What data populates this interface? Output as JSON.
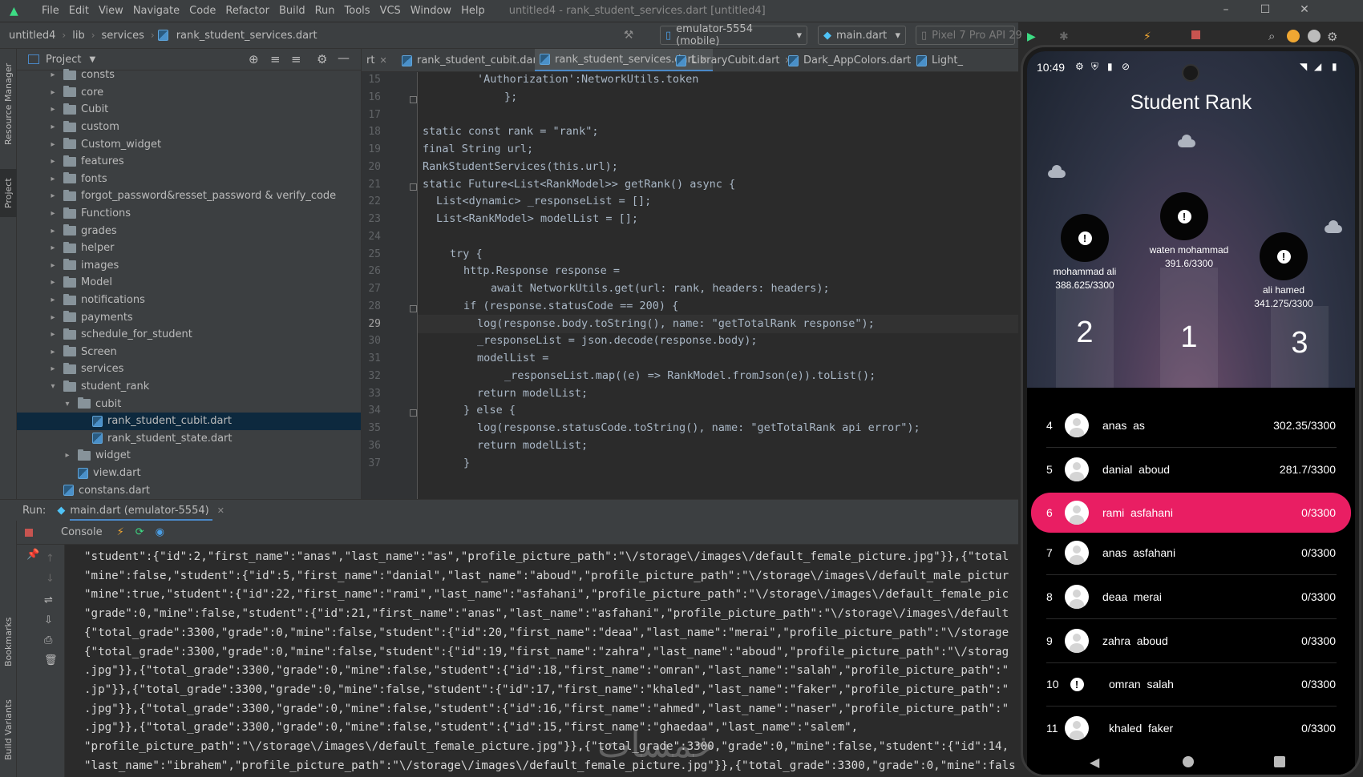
{
  "menubar": {
    "items": [
      "File",
      "Edit",
      "View",
      "Navigate",
      "Code",
      "Refactor",
      "Build",
      "Run",
      "Tools",
      "VCS",
      "Window",
      "Help"
    ],
    "title": "untitled4 - rank_student_services.dart [untitled4]"
  },
  "navbar": {
    "crumbs": [
      "untitled4",
      "lib",
      "services",
      "rank_student_services.dart"
    ],
    "device": "emulator-5554 (mobile)",
    "run_config": "main.dart",
    "avd": "Pixel 7 Pro API 29"
  },
  "leftstripe": {
    "tabs": [
      "Resource Manager",
      "Project",
      "Bookmarks",
      "Build Variants"
    ]
  },
  "project": {
    "header": "Project",
    "tree": [
      {
        "label": "consts",
        "type": "folder",
        "depth": 0,
        "expanded": false
      },
      {
        "label": "core",
        "type": "folder",
        "depth": 0,
        "expanded": false
      },
      {
        "label": "Cubit",
        "type": "folder",
        "depth": 0,
        "expanded": false
      },
      {
        "label": "custom",
        "type": "folder",
        "depth": 0,
        "expanded": false
      },
      {
        "label": "Custom_widget",
        "type": "folder",
        "depth": 0,
        "expanded": false
      },
      {
        "label": "features",
        "type": "folder",
        "depth": 0,
        "expanded": false
      },
      {
        "label": "fonts",
        "type": "folder",
        "depth": 0,
        "expanded": false
      },
      {
        "label": "forgot_password&resset_password & verify_code",
        "type": "folder",
        "depth": 0,
        "expanded": false
      },
      {
        "label": "Functions",
        "type": "folder",
        "depth": 0,
        "expanded": false
      },
      {
        "label": "grades",
        "type": "folder",
        "depth": 0,
        "expanded": false
      },
      {
        "label": "helper",
        "type": "folder",
        "depth": 0,
        "expanded": false
      },
      {
        "label": "images",
        "type": "folder",
        "depth": 0,
        "expanded": false
      },
      {
        "label": "Model",
        "type": "folder",
        "depth": 0,
        "expanded": false
      },
      {
        "label": "notifications",
        "type": "folder",
        "depth": 0,
        "expanded": false
      },
      {
        "label": "payments",
        "type": "folder",
        "depth": 0,
        "expanded": false
      },
      {
        "label": "schedule_for_student",
        "type": "folder",
        "depth": 0,
        "expanded": false
      },
      {
        "label": "Screen",
        "type": "folder",
        "depth": 0,
        "expanded": false
      },
      {
        "label": "services",
        "type": "folder",
        "depth": 0,
        "expanded": false
      },
      {
        "label": "student_rank",
        "type": "folder",
        "depth": 0,
        "expanded": true
      },
      {
        "label": "cubit",
        "type": "folder",
        "depth": 1,
        "expanded": true
      },
      {
        "label": "rank_student_cubit.dart",
        "type": "file",
        "depth": 2,
        "selected": true
      },
      {
        "label": "rank_student_state.dart",
        "type": "file",
        "depth": 2
      },
      {
        "label": "widget",
        "type": "folder",
        "depth": 1,
        "expanded": false
      },
      {
        "label": "view.dart",
        "type": "file",
        "depth": 1
      },
      {
        "label": "constans.dart",
        "type": "file",
        "depth": 0
      }
    ]
  },
  "editor_tabs": [
    {
      "label": "rt",
      "active": false
    },
    {
      "label": "rank_student_cubit.dart",
      "active": false
    },
    {
      "label": "rank_student_services.dart",
      "active": true
    },
    {
      "label": "LibraryCubit.dart",
      "active": false
    },
    {
      "label": "Dark_AppColors.dart",
      "active": false
    },
    {
      "label": "Light_",
      "active": false
    }
  ],
  "code": {
    "line_numbers": [
      "15",
      "16",
      "17",
      "18",
      "19",
      "20",
      "21",
      "22",
      "23",
      "24",
      "25",
      "26",
      "27",
      "28",
      "29",
      "30",
      "31",
      "32",
      "33",
      "34",
      "35",
      "36",
      "37"
    ],
    "lines": [
      "'Authorization':NetworkUtils.token",
      "};",
      "",
      "static const rank = \"rank\";",
      "final String url;",
      "RankStudentServices(this.url);",
      "static Future<List<RankModel>> getRank() async {",
      "List<dynamic> _responseList = [];",
      "List<RankModel> modelList = [];",
      "",
      "try {",
      "http.Response response =",
      "await NetworkUtils.get(url: rank, headers: headers);",
      "if (response.statusCode == 200) {",
      "log(response.body.toString(), name: \"getTotalRank response\");",
      "_responseList = json.decode(response.body);",
      "modelList =",
      "_responseList.map((e) => RankModel.fromJson(e)).toList();",
      "return modelList;",
      "} else {",
      "log(response.statusCode.toString(), name: \"getTotalRank api error\");",
      "return modelList;",
      "}"
    ]
  },
  "run": {
    "label": "Run:",
    "tab": "main.dart (emulator-5554)",
    "console_tab": "Console"
  },
  "console_lines": [
    "\"student\":{\"id\":2,\"first_name\":\"anas\",\"last_name\":\"as\",\"profile_picture_path\":\"\\/storage\\/images\\/default_female_picture.jpg\"}},{\"total",
    "\"mine\":false,\"student\":{\"id\":5,\"first_name\":\"danial\",\"last_name\":\"aboud\",\"profile_picture_path\":\"\\/storage\\/images\\/default_male_pictur",
    "\"mine\":true,\"student\":{\"id\":22,\"first_name\":\"rami\",\"last_name\":\"asfahani\",\"profile_picture_path\":\"\\/storage\\/images\\/default_female_pic",
    "\"grade\":0,\"mine\":false,\"student\":{\"id\":21,\"first_name\":\"anas\",\"last_name\":\"asfahani\",\"profile_picture_path\":\"\\/storage\\/images\\/default",
    "{\"total_grade\":3300,\"grade\":0,\"mine\":false,\"student\":{\"id\":20,\"first_name\":\"deaa\",\"last_name\":\"merai\",\"profile_picture_path\":\"\\/storage",
    "{\"total_grade\":3300,\"grade\":0,\"mine\":false,\"student\":{\"id\":19,\"first_name\":\"zahra\",\"last_name\":\"aboud\",\"profile_picture_path\":\"\\/storag",
    ".jpg\"}},{\"total_grade\":3300,\"grade\":0,\"mine\":false,\"student\":{\"id\":18,\"first_name\":\"omran\",\"last_name\":\"salah\",\"profile_picture_path\":\"",
    ".jp\"}},{\"total_grade\":3300,\"grade\":0,\"mine\":false,\"student\":{\"id\":17,\"first_name\":\"khaled\",\"last_name\":\"faker\",\"profile_picture_path\":\"",
    ".jpg\"}},{\"total_grade\":3300,\"grade\":0,\"mine\":false,\"student\":{\"id\":16,\"first_name\":\"ahmed\",\"last_name\":\"naser\",\"profile_picture_path\":\"",
    ".jpg\"}},{\"total_grade\":3300,\"grade\":0,\"mine\":false,\"student\":{\"id\":15,\"first_name\":\"ghaedaa\",\"last_name\":\"salem\",",
    "\"profile_picture_path\":\"\\/storage\\/images\\/default_female_picture.jpg\"}},{\"total_grade\":3300,\"grade\":0,\"mine\":false,\"student\":{\"id\":14,",
    "\"last_name\":\"ibrahem\",\"profile_picture_path\":\"\\/storage\\/images\\/default_female_picture.jpg\"}},{\"total_grade\":3300,\"grade\":0,\"mine\":fals"
  ],
  "watermark": "خمسات",
  "phone": {
    "time": "10:49",
    "title": "Student Rank",
    "podium": [
      {
        "place": "2",
        "name": "mohammad ali",
        "score": "388.625/3300"
      },
      {
        "place": "1",
        "name": "waten mohammad",
        "score": "391.6/3300"
      },
      {
        "place": "3",
        "name": "ali hamed",
        "score": "341.275/3300"
      }
    ],
    "list": [
      {
        "rank": "4",
        "name": "anas  as",
        "grade": "302.35/3300",
        "mine": false,
        "pic": "person"
      },
      {
        "rank": "5",
        "name": "danial  aboud",
        "grade": "281.7/3300",
        "mine": false,
        "pic": "person"
      },
      {
        "rank": "6",
        "name": "rami  asfahani",
        "grade": "0/3300",
        "mine": true,
        "pic": "person"
      },
      {
        "rank": "7",
        "name": "anas  asfahani",
        "grade": "0/3300",
        "mine": false,
        "pic": "person"
      },
      {
        "rank": "8",
        "name": "deaa  merai",
        "grade": "0/3300",
        "mine": false,
        "pic": "person"
      },
      {
        "rank": "9",
        "name": "zahra  aboud",
        "grade": "0/3300",
        "mine": false,
        "pic": "person"
      },
      {
        "rank": "10",
        "name": "omran  salah",
        "grade": "0/3300",
        "mine": false,
        "pic": "warning"
      },
      {
        "rank": "11",
        "name": "khaled  faker",
        "grade": "0/3300",
        "mine": false,
        "pic": "person"
      }
    ]
  }
}
